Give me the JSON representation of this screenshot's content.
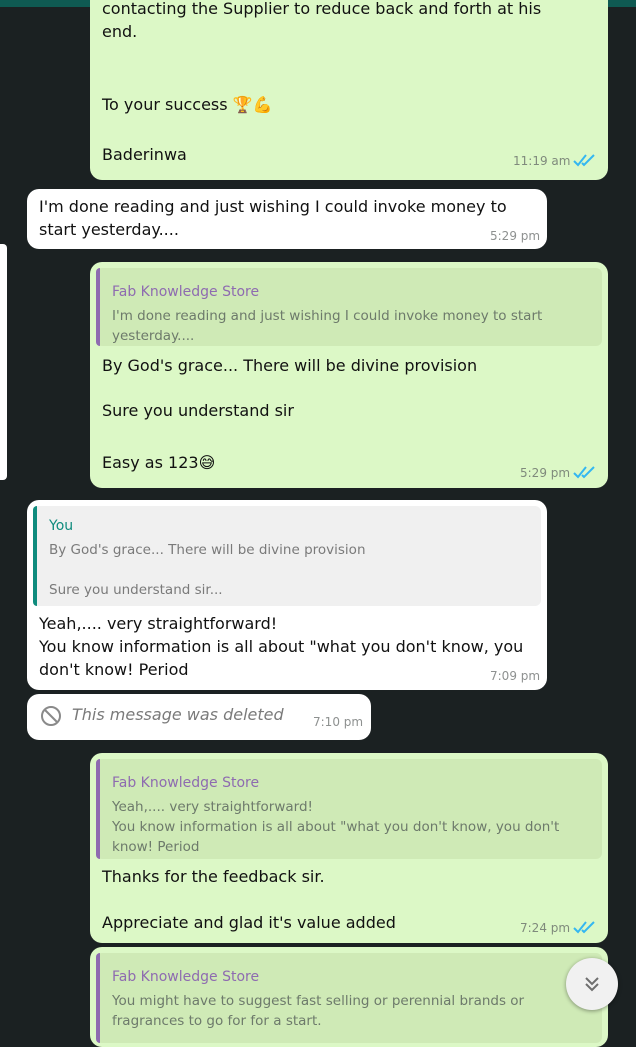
{
  "colors": {
    "background": "#1b2122",
    "outgoing_bubble": "#dcf8c6",
    "incoming_bubble": "#ffffff",
    "quote_author_store": "#8e6bb0",
    "quote_author_you": "#0f8b7d",
    "read_ticks": "#34b7f1"
  },
  "messages": [
    {
      "direction": "out",
      "lines": [
        "contacting the Supplier to reduce back and forth at his",
        "end.",
        "",
        "To your success 🏆💪",
        "",
        "Baderinwa"
      ],
      "time": "11:19 am",
      "status": "read"
    },
    {
      "direction": "in",
      "lines": [
        "I'm done reading and just wishing I could invoke money to",
        "start yesterday...."
      ],
      "time": "5:29 pm"
    },
    {
      "direction": "out",
      "quote": {
        "author": "Fab Knowledge Store",
        "lines": [
          "I'm done reading and just wishing I could invoke money to start",
          "yesterday...."
        ]
      },
      "lines": [
        "By God's grace... There will be divine provision",
        "",
        "Sure you understand sir",
        "",
        "Easy as 123😅"
      ],
      "time": "5:29 pm",
      "status": "read"
    },
    {
      "direction": "in",
      "quote": {
        "author": "You",
        "lines": [
          "By God's grace... There will be divine provision",
          "",
          "Sure you understand sir..."
        ]
      },
      "lines": [
        "Yeah,.... very straightforward!",
        "You know information is all about \"what you don't know, you",
        "don't know! Period"
      ],
      "time": "7:09 pm"
    },
    {
      "direction": "in",
      "deleted": true,
      "text": "This message was deleted",
      "time": "7:10 pm"
    },
    {
      "direction": "out",
      "quote": {
        "author": "Fab Knowledge Store",
        "lines": [
          "Yeah,.... very straightforward!",
          "You know information is all about \"what you don't know, you don't",
          "know! Period"
        ]
      },
      "lines": [
        "Thanks for the feedback sir.",
        "",
        "Appreciate and glad it's value added"
      ],
      "time": "7:24 pm",
      "status": "read"
    },
    {
      "direction": "out",
      "quote": {
        "author": "Fab Knowledge Store",
        "lines": [
          "You might have to suggest fast selling or perennial brands or",
          "fragrances to go for for a start."
        ]
      }
    }
  ],
  "scroll_button": {
    "icon": "double-chevron-down-icon"
  }
}
